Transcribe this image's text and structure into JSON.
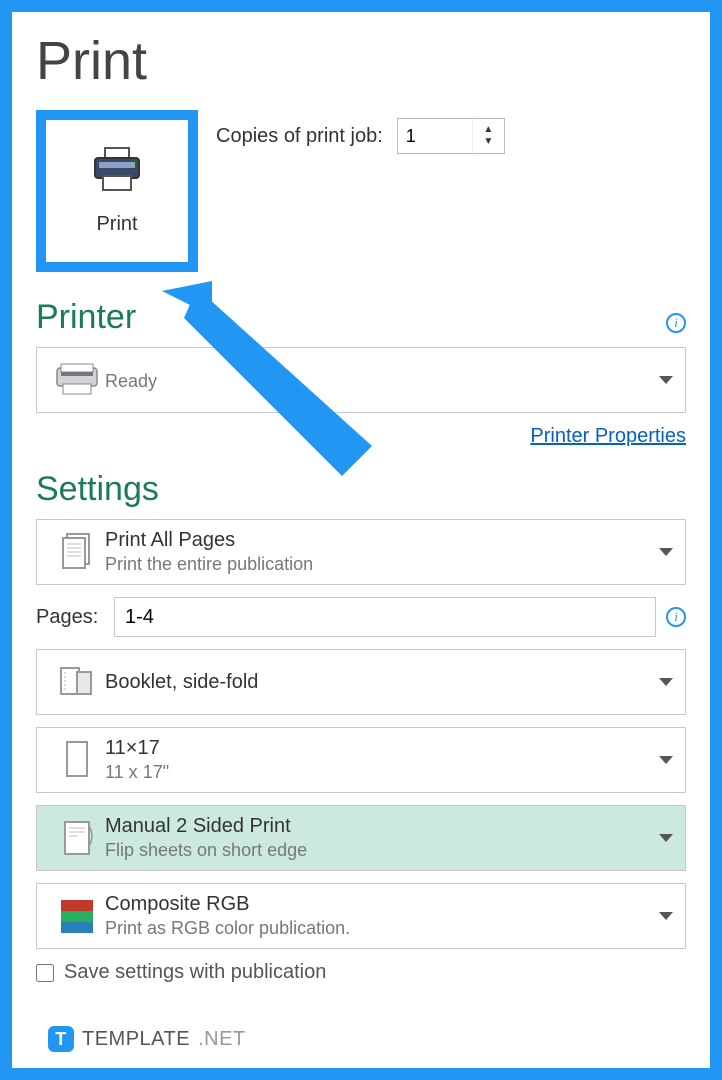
{
  "page_title": "Print",
  "print_button_label": "Print",
  "copies": {
    "label": "Copies of print job:",
    "value": "1"
  },
  "printer": {
    "section_title": "Printer",
    "status": "Ready",
    "properties_link": "Printer Properties"
  },
  "settings": {
    "section_title": "Settings",
    "print_range": {
      "title": "Print All Pages",
      "sub": "Print the entire publication"
    },
    "pages": {
      "label": "Pages:",
      "value": "1-4"
    },
    "layout": {
      "title": "Booklet, side-fold"
    },
    "paper": {
      "title": "11×17",
      "sub": "11 x 17\""
    },
    "duplex": {
      "title": "Manual 2 Sided Print",
      "sub": "Flip sheets on short edge"
    },
    "color": {
      "title": "Composite RGB",
      "sub": "Print as RGB color publication."
    },
    "save_checkbox": "Save settings with publication"
  },
  "watermark": {
    "brand": "TEMPLATE",
    "suffix": ".NET"
  }
}
